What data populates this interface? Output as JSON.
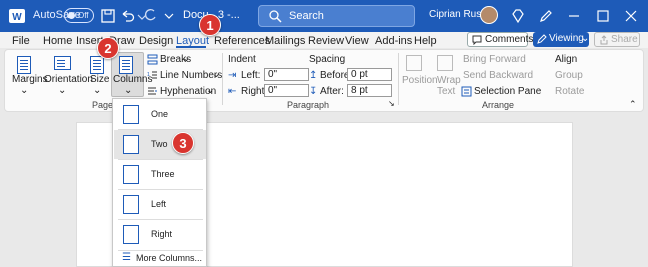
{
  "titlebar": {
    "autosave_label": "AutoSave",
    "autosave_state": "Off",
    "doc_title": "Docu...3 -...",
    "search_placeholder": "Search",
    "user_name": "Ciprian Rusen"
  },
  "menu": {
    "tabs": [
      "File",
      "Home",
      "Insert",
      "Draw",
      "Design",
      "Layout",
      "References",
      "Mailings",
      "Review",
      "View",
      "Add-ins",
      "Help"
    ],
    "active_tab": "Layout",
    "comments_label": "Comments",
    "viewing_label": "Viewing",
    "share_label": "Share"
  },
  "ribbon": {
    "page_setup": {
      "margins": "Margins",
      "orientation": "Orientation",
      "size": "Size",
      "columns": "Columns",
      "breaks": "Breaks",
      "line_numbers": "Line Numbers",
      "hyphenation": "Hyphenation",
      "group_label": "Page S"
    },
    "paragraph": {
      "indent_label": "Indent",
      "left_label": "Left:",
      "left_value": "0\"",
      "right_label": "Right:",
      "right_value": "0\"",
      "spacing_label": "Spacing",
      "before_label": "Before:",
      "before_value": "0 pt",
      "after_label": "After:",
      "after_value": "8 pt",
      "group_label": "Paragraph"
    },
    "arrange": {
      "position": "Position",
      "wrap_text_1": "Wrap",
      "wrap_text_2": "Text",
      "bring_forward": "Bring Forward",
      "send_backward": "Send Backward",
      "selection_pane": "Selection Pane",
      "align": "Align",
      "group": "Group",
      "rotate": "Rotate",
      "group_label": "Arrange"
    }
  },
  "columns_menu": {
    "items": [
      "One",
      "Two",
      "Three",
      "Left",
      "Right"
    ],
    "highlighted": "Two",
    "more": "More Columns..."
  },
  "markers": [
    "1",
    "2",
    "3"
  ],
  "colors": {
    "accent": "#1e5bb8",
    "marker": "#d9352f"
  }
}
